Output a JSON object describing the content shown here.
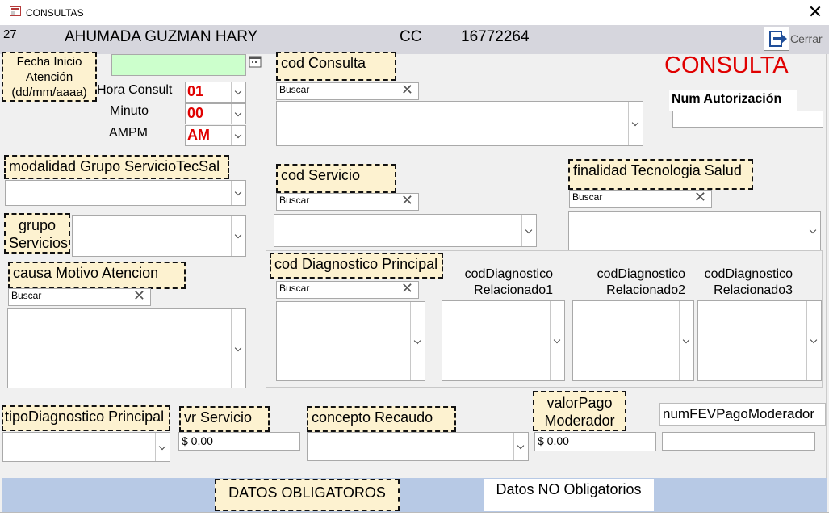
{
  "window": {
    "title": "CONSULTAS",
    "close_glyph": "✕"
  },
  "header": {
    "id": "27",
    "patient_name": "AHUMADA GUZMAN HARY",
    "doc_type": "CC",
    "doc_number": "16772264",
    "close_label": "Cerrar"
  },
  "form": {
    "heading": "CONSULTA",
    "fecha_label": "Fecha Inicio Atención (dd/mm/aaaa)",
    "fecha_value": "",
    "hora_label": "Hora Consult",
    "hora_value": "01",
    "minuto_label": "Minuto",
    "minuto_value": "00",
    "ampm_label": "AMPM",
    "ampm_value": "AM",
    "cod_consulta_label": "cod Consulta",
    "num_autorizacion_label": "Num Autorización",
    "modalidad_label": "modalidad Grupo ServicioTecSal",
    "cod_servicio_label": "cod Servicio",
    "finalidad_label": "finalidad Tecnologia Salud",
    "grupo_servicios_label": "grupo Servicios",
    "causa_label": "causa Motivo Atencion",
    "diag_principal_label": "cod Diagnostico Principal",
    "diag_rel1_label": "codDiagnostico Relacionado1",
    "diag_rel2_label": "codDiagnostico Relacionado2",
    "diag_rel3_label": "codDiagnostico Relacionado3",
    "tipo_diag_label": "tipoDiagnostico Principal",
    "vr_servicio_label": "vr Servicio",
    "vr_servicio_value": "$ 0.00",
    "concepto_recaudo_label": "concepto Recaudo",
    "valor_pago_label": "valorPago Moderador",
    "valor_pago_value": "$ 0.00",
    "num_fev_label": "numFEVPagoModerador",
    "search_placeholder": "Buscar"
  },
  "footer": {
    "obligatorios": "DATOS OBLIGATOROS",
    "no_obligatorios": "Datos NO Obligatorios"
  },
  "colors": {
    "heading_red": "#e00000",
    "label_bg": "#fdf2d0",
    "date_green": "#ccffcc",
    "footer_blue": "#b7c9e5"
  },
  "icons": {
    "calendar": "calendar-icon",
    "exit": "exit-door-icon",
    "clear": "clear-x-icon",
    "dropdown": "chevron-down-icon",
    "app": "form-window-icon"
  }
}
